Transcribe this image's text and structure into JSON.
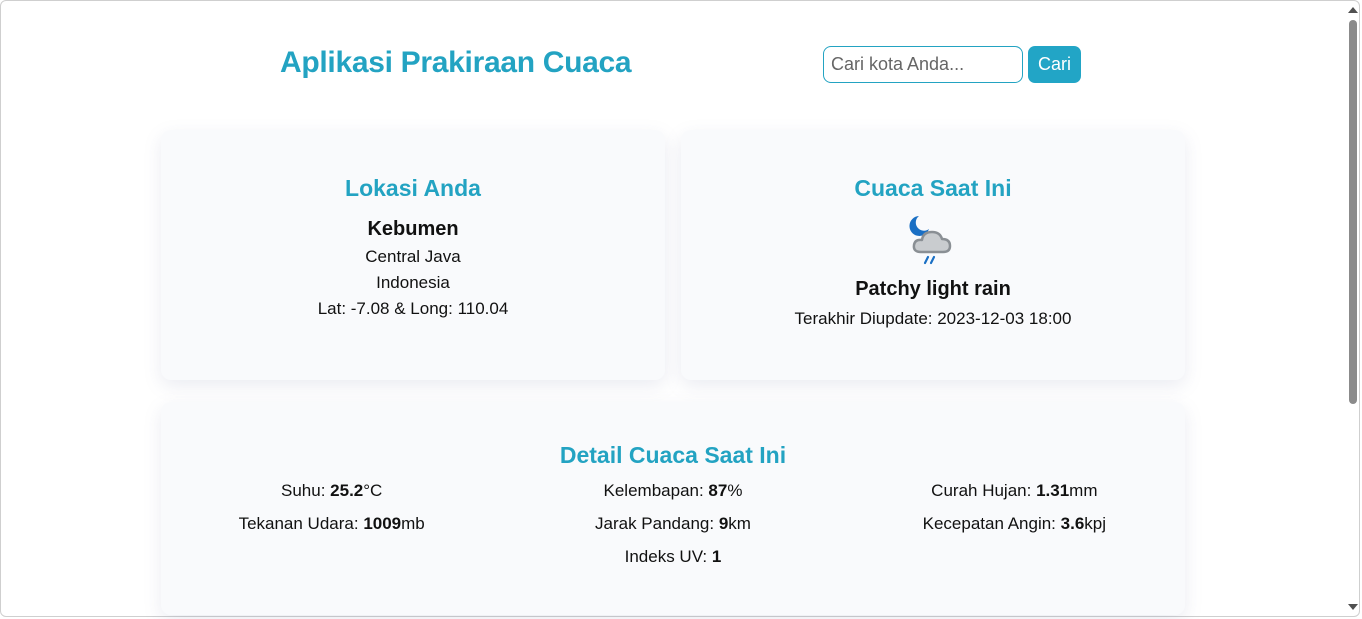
{
  "header": {
    "title": "Aplikasi Prakiraan Cuaca",
    "search_placeholder": "Cari kota Anda...",
    "search_button": "Cari"
  },
  "location": {
    "heading": "Lokasi Anda",
    "city": "Kebumen",
    "region": "Central Java",
    "country": "Indonesia",
    "coords": "Lat: -7.08 & Long: 110.04"
  },
  "current": {
    "heading": "Cuaca Saat Ini",
    "icon": "night-cloud-rain-icon",
    "condition": "Patchy light rain",
    "updated": "Terakhir Diupdate: 2023-12-03 18:00"
  },
  "details": {
    "heading": "Detail Cuaca Saat Ini",
    "items": [
      {
        "label": "Suhu: ",
        "value": "25.2",
        "unit": "°C"
      },
      {
        "label": "Kelembapan: ",
        "value": "87",
        "unit": "%"
      },
      {
        "label": "Curah Hujan: ",
        "value": "1.31",
        "unit": "mm"
      },
      {
        "label": "Tekanan Udara: ",
        "value": "1009",
        "unit": "mb"
      },
      {
        "label": "Jarak Pandang: ",
        "value": "9",
        "unit": "km"
      },
      {
        "label": "Kecepatan Angin: ",
        "value": "3.6",
        "unit": "kpj"
      },
      {
        "label": "Indeks UV: ",
        "value": "1",
        "unit": ""
      }
    ]
  },
  "colors": {
    "accent": "#23a3c2",
    "card_bg": "#f9fafc"
  }
}
